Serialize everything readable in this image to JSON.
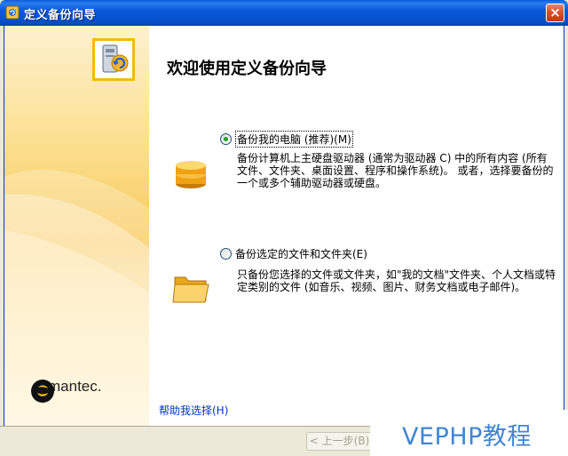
{
  "window": {
    "title": "定义备份向导",
    "close_label": "×"
  },
  "wizard": {
    "heading": "欢迎使用定义备份向导",
    "options": [
      {
        "label": "备份我的电脑 (推荐)(M)",
        "selected": true,
        "icon": "drive-stack-icon",
        "description": "备份计算机上主硬盘驱动器 (通常为驱动器 C) 中的所有内容 (所有文件、文件夹、桌面设置、程序和操作系统)。 或者，选择要备份的一个或多个辅助驱动器或硬盘。"
      },
      {
        "label": "备份选定的文件和文件夹(E)",
        "selected": false,
        "icon": "folder-icon",
        "description": "只备份您选择的文件或文件夹，如\"我的文档\"文件夹、个人文档或特定类别的文件 (如音乐、视频、图片、财务文档或电子邮件)。"
      }
    ],
    "help_link": "帮助我选择(H)"
  },
  "brand": {
    "name": "symantec.",
    "accent": "#f8c85a"
  },
  "footer": {
    "back_label": "< 上一步(B)"
  },
  "watermark": {
    "text": "VEPHP教程"
  }
}
